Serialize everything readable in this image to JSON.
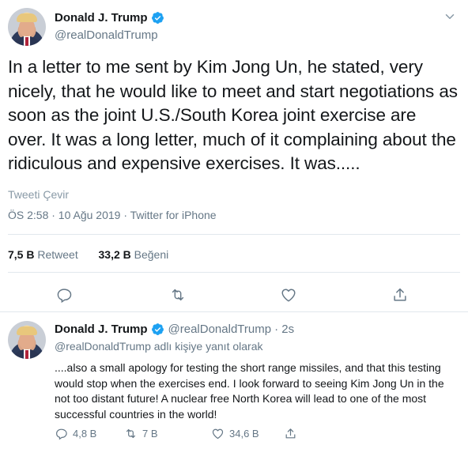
{
  "main_tweet": {
    "author_name": "Donald J. Trump",
    "author_handle": "@realDonaldTrump",
    "text": "In a letter to me sent by Kim Jong Un, he stated, very nicely, that he would like to meet and start negotiations as soon as the joint U.S./South Korea joint exercise are over. It was a long letter, much of it complaining about the ridiculous and expensive exercises. It was.....",
    "translate_label": "Tweeti Çevir",
    "timestamp": "ÖS 2:58 · 10 Ağu 2019 · ",
    "source": "Twitter for iPhone",
    "retweet_count": "7,5 B",
    "retweet_label": "Retweet",
    "like_count": "33,2 B",
    "like_label": "Beğeni"
  },
  "reply_tweet": {
    "author_name": "Donald J. Trump",
    "author_handle": "@realDonaldTrump",
    "time": "· 2s",
    "replying_to_handle": "@realDonaldTrump",
    "replying_to_suffix": " adlı kişiye yanıt olarak",
    "text": "....also a small apology for testing the short range missiles, and that this testing would stop when the exercises end. I look forward to seeing Kim Jong Un in the not too distant future! A nuclear free North Korea will lead to one of the most successful countries in the world!",
    "reply_count": "4,8 B",
    "retweet_count": "7 B",
    "like_count": "34,6 B"
  },
  "colors": {
    "text": "#14171a",
    "secondary": "#657786",
    "link": "#1da1f2",
    "divider": "#e1e8ed"
  },
  "icons": [
    "verified-badge-icon",
    "chevron-down-icon",
    "reply-icon",
    "retweet-icon",
    "like-icon",
    "share-icon"
  ]
}
